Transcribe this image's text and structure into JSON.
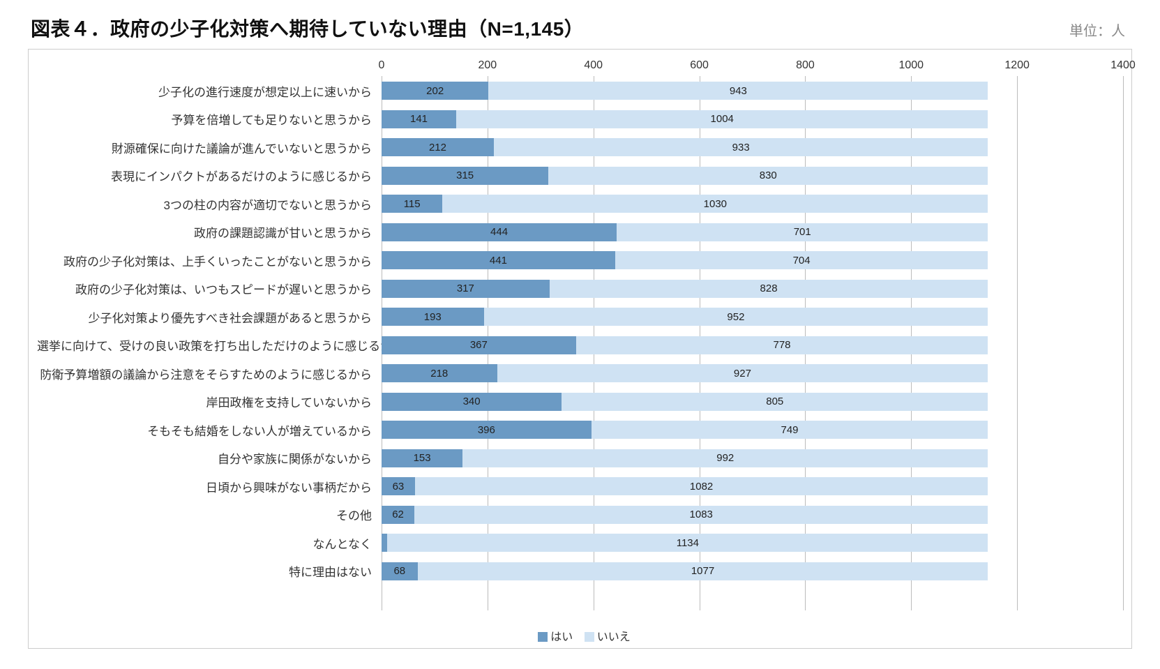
{
  "header": {
    "title": "図表４．政府の少子化対策へ期待していない理由（N=1,145）",
    "unit": "単位：人"
  },
  "legend": {
    "yes": "はい",
    "no": "いいえ"
  },
  "chart_data": {
    "type": "bar",
    "stacked": true,
    "orientation": "horizontal",
    "title": "図表４．政府の少子化対策へ期待していない理由（N=1,145）",
    "xlabel": "",
    "ylabel": "",
    "xlim": [
      0,
      1400
    ],
    "xticks": [
      0,
      200,
      400,
      600,
      800,
      1000,
      1200,
      1400
    ],
    "categories": [
      "少子化の進行速度が想定以上に速いから",
      "予算を倍増しても足りないと思うから",
      "財源確保に向けた議論が進んでいないと思うから",
      "表現にインパクトがあるだけのように感じるから",
      "3つの柱の内容が適切でないと思うから",
      "政府の課題認識が甘いと思うから",
      "政府の少子化対策は、上手くいったことがないと思うから",
      "政府の少子化対策は、いつもスピードが遅いと思うから",
      "少子化対策より優先すべき社会課題があると思うから",
      "選挙に向けて、受けの良い政策を打ち出しただけのように感じるから",
      "防衛予算増額の議論から注意をそらすためのように感じるから",
      "岸田政権を支持していないから",
      "そもそも結婚をしない人が増えているから",
      "自分や家族に関係がないから",
      "日頃から興味がない事柄だから",
      "その他",
      "なんとなく",
      "特に理由はない"
    ],
    "series": [
      {
        "name": "はい",
        "values": [
          202,
          141,
          212,
          315,
          115,
          444,
          441,
          317,
          193,
          367,
          218,
          340,
          396,
          153,
          63,
          62,
          11,
          68
        ]
      },
      {
        "name": "いいえ",
        "values": [
          943,
          1004,
          933,
          830,
          1030,
          701,
          704,
          828,
          952,
          778,
          927,
          805,
          749,
          992,
          1082,
          1083,
          1134,
          1077
        ]
      }
    ],
    "legend_position": "bottom",
    "grid": {
      "x": true,
      "y": false
    }
  }
}
